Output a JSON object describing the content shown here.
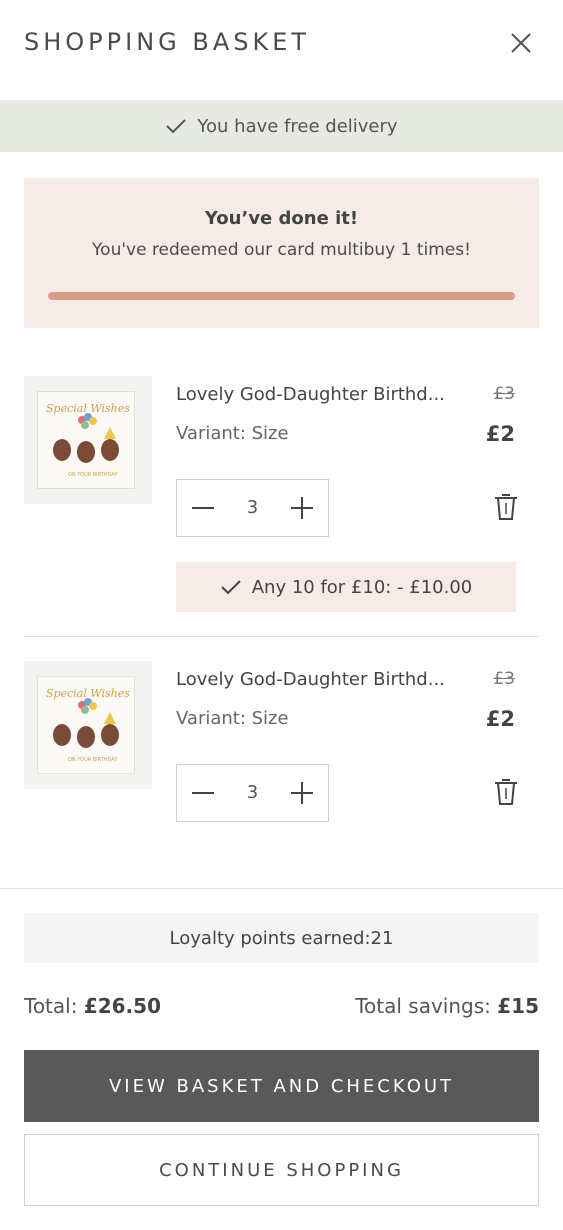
{
  "header": {
    "title": "SHOPPING BASKET",
    "close_icon": "close-icon"
  },
  "delivery_banner": {
    "text": "You have free delivery",
    "icon": "check-icon"
  },
  "promo": {
    "title": "You’ve done it!",
    "subtitle": "You've redeemed our card multibuy 1 times!",
    "progress": 1.0
  },
  "items": [
    {
      "name": "Lovely God-Daughter Birthd...",
      "old_price": "£3",
      "variant": "Variant: Size",
      "price": "£2",
      "quantity": "3",
      "offer": "Any 10 for £10: - £10.00"
    },
    {
      "name": "Lovely God-Daughter Birthd...",
      "old_price": "£3",
      "variant": "Variant: Size",
      "price": "£2",
      "quantity": "3"
    }
  ],
  "loyalty": {
    "text": "Loyalty points earned:21"
  },
  "totals": {
    "total_label": "Total:",
    "total_value": "£26.50",
    "savings_label": "Total savings:",
    "savings_value": "£15"
  },
  "buttons": {
    "checkout": "VIEW BASKET AND CHECKOUT",
    "continue": "CONTINUE SHOPPING"
  },
  "colors": {
    "banner_bg": "#e7e9e3",
    "promo_bg": "#f7ebe8",
    "progress_fill": "#d89c8a",
    "checkout_bg": "#595959"
  }
}
